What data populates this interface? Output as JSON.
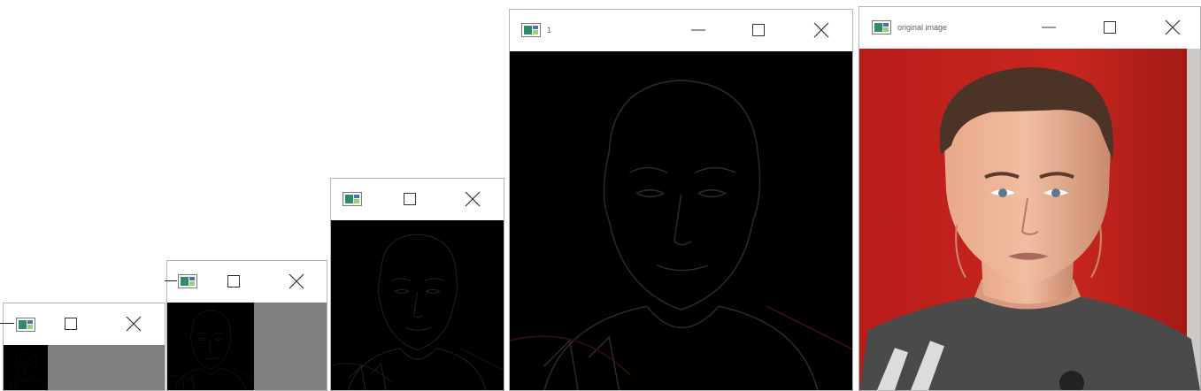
{
  "windows": [
    {
      "id": "w1",
      "title": ""
    },
    {
      "id": "w2",
      "title": ""
    },
    {
      "id": "w3",
      "title": ""
    },
    {
      "id": "w4",
      "title": "1"
    },
    {
      "id": "w5",
      "title": "original image"
    }
  ],
  "controls": {
    "minimize_icon": "minimize-icon",
    "maximize_icon": "maximize-icon",
    "close_icon": "close-icon"
  },
  "colors": {
    "titlebar": "#ffffff",
    "client_background": "#7f7f7f",
    "edge_image_background": "#000000",
    "photo_background": "#c0231e",
    "window_border": "#b4b4b4"
  }
}
